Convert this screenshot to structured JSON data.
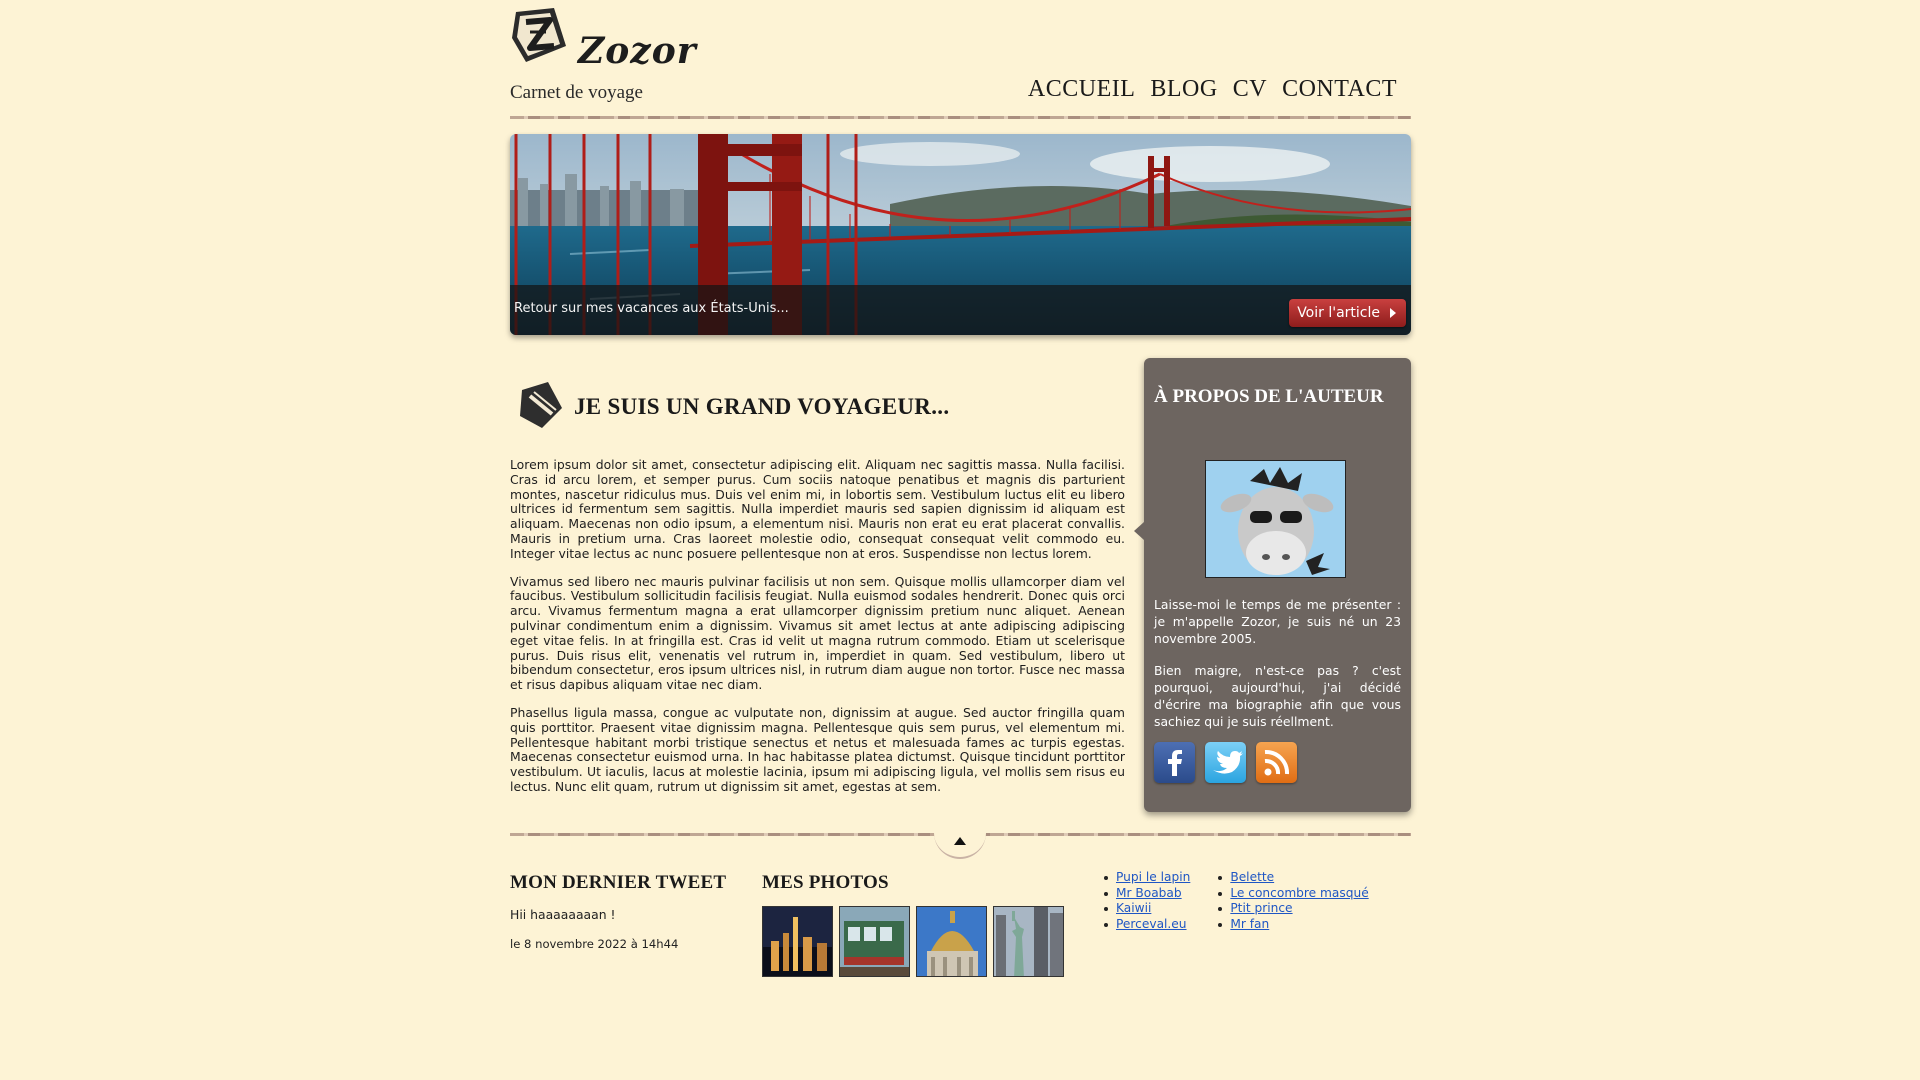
{
  "brand": {
    "name": "Zozor",
    "tagline": "Carnet de voyage"
  },
  "nav": {
    "items": [
      "ACCUEIL",
      "BLOG",
      "CV",
      "CONTACT"
    ]
  },
  "banner": {
    "caption": "Retour sur mes vacances aux États-Unis...",
    "button_label": "Voir l'article"
  },
  "article": {
    "title": "JE SUIS UN GRAND VOYAGEUR...",
    "paragraphs": [
      "Lorem ipsum dolor sit amet, consectetur adipiscing elit. Aliquam nec sagittis massa. Nulla facilisi. Cras id arcu lorem, et semper purus. Cum sociis natoque penatibus et magnis dis parturient montes, nascetur ridiculus mus. Duis vel enim mi, in lobortis sem. Vestibulum luctus elit eu libero ultrices id fermentum sem sagittis. Nulla imperdiet mauris sed sapien dignissim id aliquam est aliquam. Maecenas non odio ipsum, a elementum nisi. Mauris non erat eu erat placerat convallis. Mauris in pretium urna. Cras laoreet molestie odio, consequat consequat velit commodo eu. Integer vitae lectus ac nunc posuere pellentesque non at eros. Suspendisse non lectus lorem.",
      "Vivamus sed libero nec mauris pulvinar facilisis ut non sem. Quisque mollis ullamcorper diam vel faucibus. Vestibulum sollicitudin facilisis feugiat. Nulla euismod sodales hendrerit. Donec quis orci arcu. Vivamus fermentum magna a erat ullamcorper dignissim pretium nunc aliquet. Aenean pulvinar condimentum enim a dignissim. Vivamus sit amet lectus at ante adipiscing adipiscing eget vitae felis. In at fringilla est. Cras id velit ut magna rutrum commodo. Etiam ut scelerisque purus. Duis risus elit, venenatis vel rutrum in, imperdiet in quam. Sed vestibulum, libero ut bibendum consectetur, eros ipsum ultrices nisl, in rutrum diam augue non tortor. Fusce nec massa et risus dapibus aliquam vitae nec diam.",
      "Phasellus ligula massa, congue ac vulputate non, dignissim at augue. Sed auctor fringilla quam quis porttitor. Praesent vitae dignissim magna. Pellentesque quis sem purus, vel elementum mi. Pellentesque habitant morbi tristique senectus et netus et malesuada fames ac turpis egestas. Maecenas consectetur euismod urna. In hac habitasse platea dictumst. Quisque tincidunt porttitor vestibulum. Ut iaculis, lacus at molestie lacinia, ipsum mi adipiscing ligula, vel mollis sem risus eu lectus. Nunc elit quam, rutrum ut dignissim sit amet, egestas at sem."
    ]
  },
  "sidebar": {
    "title": "À PROPOS DE L'AUTEUR",
    "paragraphs": [
      "Laisse-moi le temps de me présenter : je m'appelle Zozor, je suis né un 23 novembre 2005.",
      "Bien maigre, n'est-ce pas ? c'est pourquoi, aujourd'hui, j'ai décidé d'écrire ma biographie afin que vous sachiez qui je suis réellment."
    ],
    "socials": [
      "facebook-icon",
      "twitter-icon",
      "rss-icon"
    ]
  },
  "footer": {
    "tweet": {
      "title": "MON DERNIER TWEET",
      "text": "Hii haaaaaaaan !",
      "date": "le 8 novembre 2022 à 14h44"
    },
    "photos": {
      "title": "MES PHOTOS",
      "items": [
        "new-york-night-photo",
        "cable-car-photo",
        "dome-photo",
        "statue-of-liberty-photo"
      ]
    },
    "links": {
      "col1": [
        "Pupi le lapin",
        "Mr Boabab",
        "Kaiwii",
        "Perceval.eu"
      ],
      "col2": [
        "Belette",
        "Le concombre masqué",
        "Ptit prince",
        "Mr fan"
      ]
    }
  },
  "colors": {
    "background": "#fdf3d5",
    "sidebar": "#6d6560",
    "button": "#b02b2a",
    "link": "#1f56c4"
  }
}
